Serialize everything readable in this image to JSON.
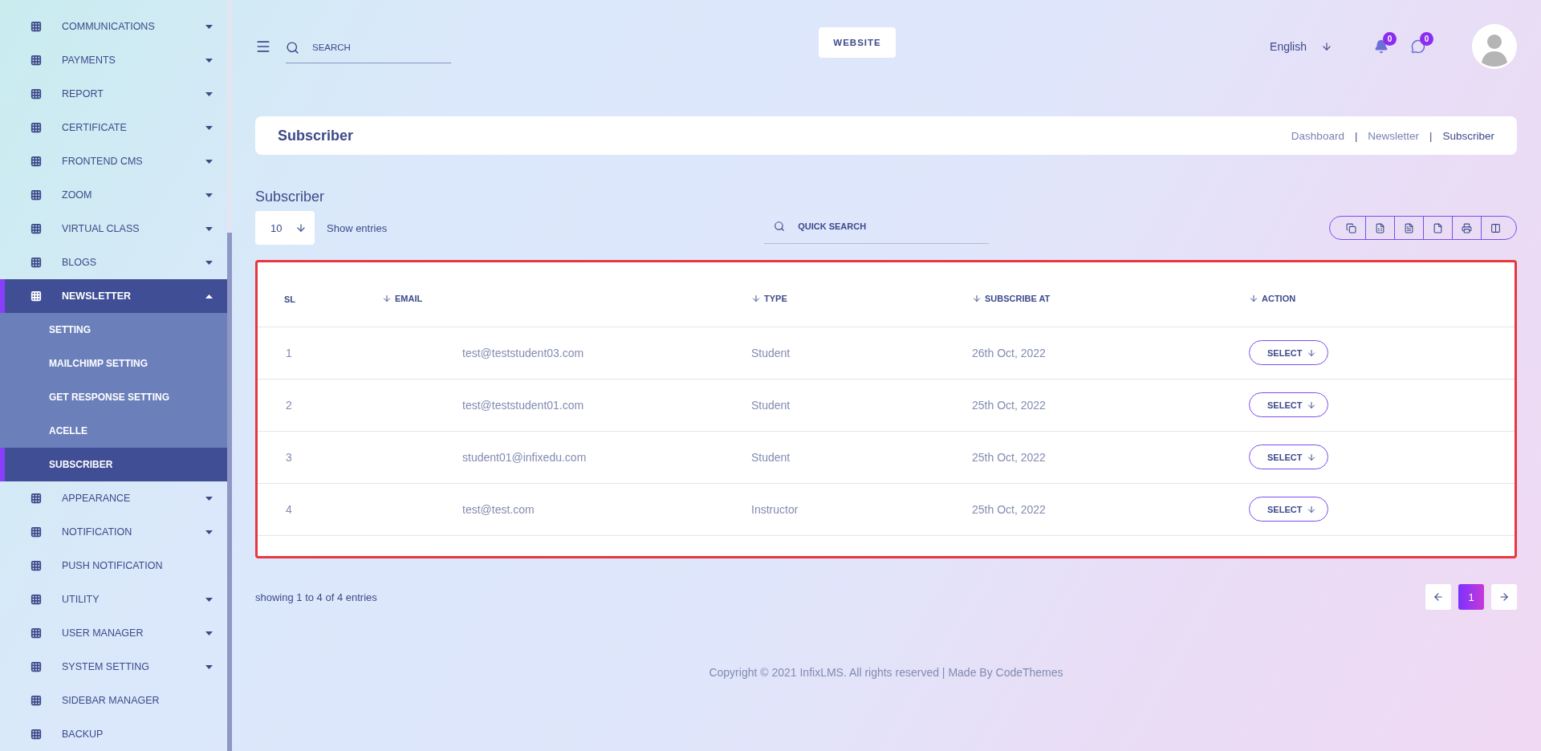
{
  "sidebar": {
    "items": [
      {
        "label": "COMMUNICATIONS",
        "kind": "menu",
        "expanded": false
      },
      {
        "label": "PAYMENTS",
        "kind": "menu",
        "expanded": false
      },
      {
        "label": "REPORT",
        "kind": "menu",
        "expanded": false
      },
      {
        "label": "CERTIFICATE",
        "kind": "menu",
        "expanded": false
      },
      {
        "label": "FRONTEND CMS",
        "kind": "menu",
        "expanded": false
      },
      {
        "label": "ZOOM",
        "kind": "menu",
        "expanded": false
      },
      {
        "label": "VIRTUAL CLASS",
        "kind": "menu",
        "expanded": false
      },
      {
        "label": "BLOGS",
        "kind": "menu",
        "expanded": false
      },
      {
        "label": "NEWSLETTER",
        "kind": "menu",
        "expanded": true,
        "children": [
          {
            "label": "SETTING",
            "selected": false
          },
          {
            "label": "MAILCHIMP SETTING",
            "selected": false
          },
          {
            "label": "GET RESPONSE SETTING",
            "selected": false
          },
          {
            "label": "ACELLE",
            "selected": false
          },
          {
            "label": "SUBSCRIBER",
            "selected": true
          }
        ]
      },
      {
        "label": "APPEARANCE",
        "kind": "menu",
        "expanded": false
      },
      {
        "label": "NOTIFICATION",
        "kind": "menu",
        "expanded": false
      },
      {
        "label": "PUSH NOTIFICATION",
        "kind": "link"
      },
      {
        "label": "UTILITY",
        "kind": "menu",
        "expanded": false
      },
      {
        "label": "USER MANAGER",
        "kind": "menu",
        "expanded": false
      },
      {
        "label": "SYSTEM SETTING",
        "kind": "menu",
        "expanded": false
      },
      {
        "label": "SIDEBAR MANAGER",
        "kind": "link"
      },
      {
        "label": "BACKUP",
        "kind": "link"
      }
    ]
  },
  "header": {
    "search": {
      "placeholder": "SEARCH"
    },
    "website_button": "WEBSITE",
    "language": "English",
    "notifications_count": "0",
    "messages_count": "0"
  },
  "page_title": {
    "title": "Subscriber",
    "separator": "|",
    "breadcrumb": [
      {
        "label": "Dashboard",
        "selected": false
      },
      {
        "label": "Newsletter",
        "selected": false
      },
      {
        "label": "Subscriber",
        "selected": true
      }
    ]
  },
  "section_title": "Subscriber",
  "controls": {
    "page_size": "10",
    "page_size_label": "Show entries",
    "search": {
      "placeholder": "QUICK SEARCH"
    },
    "export_buttons": [
      {
        "kind": "copy"
      },
      {
        "kind": "excel"
      },
      {
        "kind": "csv"
      },
      {
        "kind": "pdf"
      },
      {
        "kind": "print"
      },
      {
        "kind": "columns"
      }
    ]
  },
  "table": {
    "columns": [
      {
        "label": "SL",
        "sortable": false
      },
      {
        "label": "EMAIL",
        "sortable": true
      },
      {
        "label": "TYPE",
        "sortable": true
      },
      {
        "label": "SUBSCRIBE AT",
        "sortable": true
      },
      {
        "label": "ACTION",
        "sortable": true
      }
    ],
    "rows": [
      {
        "sl": "1",
        "email": "test@teststudent03.com",
        "type": "Student",
        "subscribe_at": "26th Oct, 2022",
        "action": "SELECT"
      },
      {
        "sl": "2",
        "email": "test@teststudent01.com",
        "type": "Student",
        "subscribe_at": "25th Oct, 2022",
        "action": "SELECT"
      },
      {
        "sl": "3",
        "email": "student01@infixedu.com",
        "type": "Student",
        "subscribe_at": "25th Oct, 2022",
        "action": "SELECT"
      },
      {
        "sl": "4",
        "email": "test@test.com",
        "type": "Instructor",
        "subscribe_at": "25th Oct, 2022",
        "action": "SELECT"
      }
    ]
  },
  "pagination": {
    "info": "showing 1 to 4 of 4 entries",
    "pages": [
      {
        "label": "1",
        "selected": true
      }
    ]
  },
  "footer": "Copyright © 2021 InfixLMS. All rights reserved | Made By CodeThemes"
}
